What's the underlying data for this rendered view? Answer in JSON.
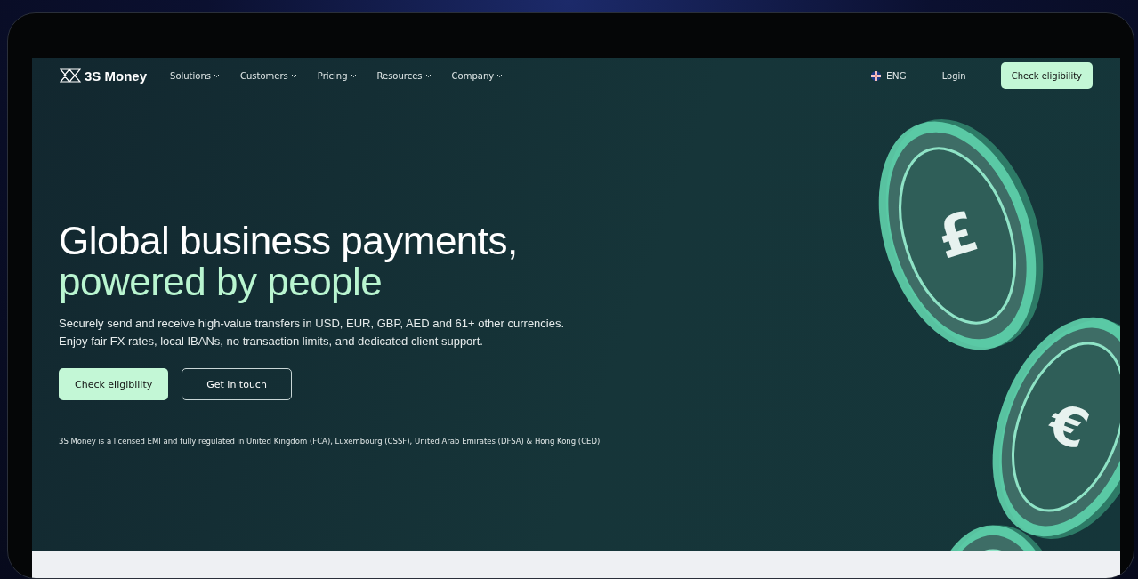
{
  "nav": {
    "logo": "3S Money",
    "menu": [
      {
        "label": "Solutions"
      },
      {
        "label": "Customers"
      },
      {
        "label": "Pricing"
      },
      {
        "label": "Resources"
      },
      {
        "label": "Company"
      }
    ],
    "language": "ENG",
    "login": "Login",
    "cta": "Check eligibility"
  },
  "hero": {
    "title": "Global business payments,",
    "title_highlight": "powered by people",
    "subtitle": [
      "Securely send and receive high-value transfers in USD, EUR, GBP, AED and 61+ other currencies.",
      "Enjoy fair FX rates, local IBANs, no transaction limits, and dedicated client support."
    ],
    "buttons": [
      {
        "label": "Check eligibility",
        "kind": "primary"
      },
      {
        "label": "Get in touch",
        "kind": "outline"
      }
    ],
    "disclaimer": "3S Money is a licensed EMI and fully regulated in United Kingdom (FCA), Luxembourg (CSSF), United Arab Emirates (DFSA) & Hong Kong (CED)",
    "coins": [
      {
        "symbol": "£"
      },
      {
        "symbol": "€"
      }
    ]
  }
}
